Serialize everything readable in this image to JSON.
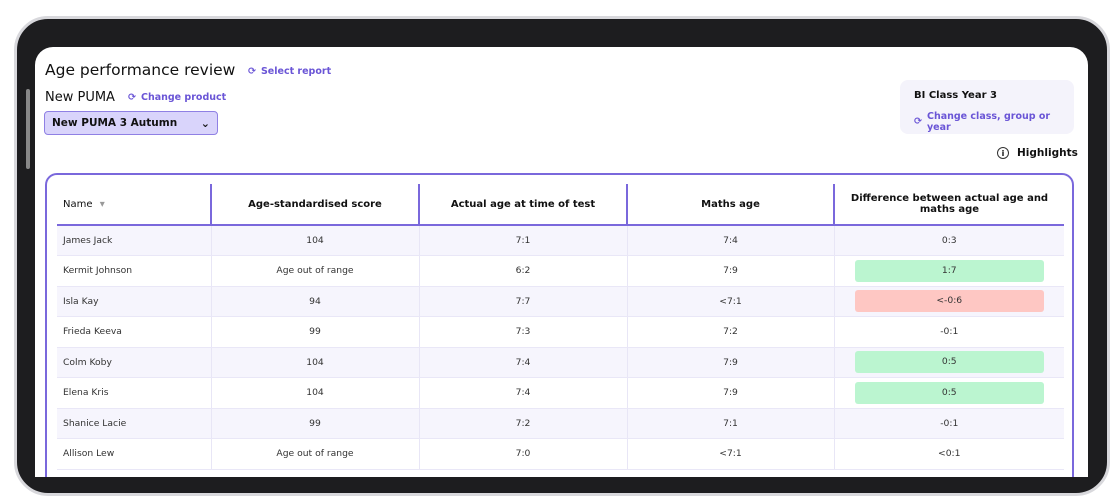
{
  "header": {
    "title": "Age performance review",
    "select_report": "Select report",
    "product": "New PUMA",
    "change_product": "Change product",
    "dropdown_value": "New PUMA 3 Autumn"
  },
  "class_box": {
    "name": "BI Class Year 3",
    "change": "Change class, group or year"
  },
  "highlights": "Highlights",
  "colors": {
    "accent": "#6a55d6",
    "positive": "#bbf5d0",
    "negative": "#fec7c3"
  },
  "table": {
    "columns": [
      "Name",
      "Age-standardised score",
      "Actual age at time of test",
      "Maths age",
      "Difference between actual age and maths age"
    ],
    "rows": [
      {
        "name": "James Jack",
        "score": "104",
        "actual": "7:1",
        "maths": "7:4",
        "diff": "0:3",
        "status": "none"
      },
      {
        "name": "Kermit Johnson",
        "score": "Age out of range",
        "actual": "6:2",
        "maths": "7:9",
        "diff": "1:7",
        "status": "good"
      },
      {
        "name": "Isla Kay",
        "score": "94",
        "actual": "7:7",
        "maths": "<7:1",
        "diff": "<-0:6",
        "status": "bad"
      },
      {
        "name": "Frieda Keeva",
        "score": "99",
        "actual": "7:3",
        "maths": "7:2",
        "diff": "-0:1",
        "status": "none"
      },
      {
        "name": "Colm Koby",
        "score": "104",
        "actual": "7:4",
        "maths": "7:9",
        "diff": "0:5",
        "status": "good"
      },
      {
        "name": "Elena Kris",
        "score": "104",
        "actual": "7:4",
        "maths": "7:9",
        "diff": "0:5",
        "status": "good"
      },
      {
        "name": "Shanice Lacie",
        "score": "99",
        "actual": "7:2",
        "maths": "7:1",
        "diff": "-0:1",
        "status": "none"
      },
      {
        "name": "Allison Lew",
        "score": "Age out of range",
        "actual": "7:0",
        "maths": "<7:1",
        "diff": "<0:1",
        "status": "none"
      }
    ]
  }
}
